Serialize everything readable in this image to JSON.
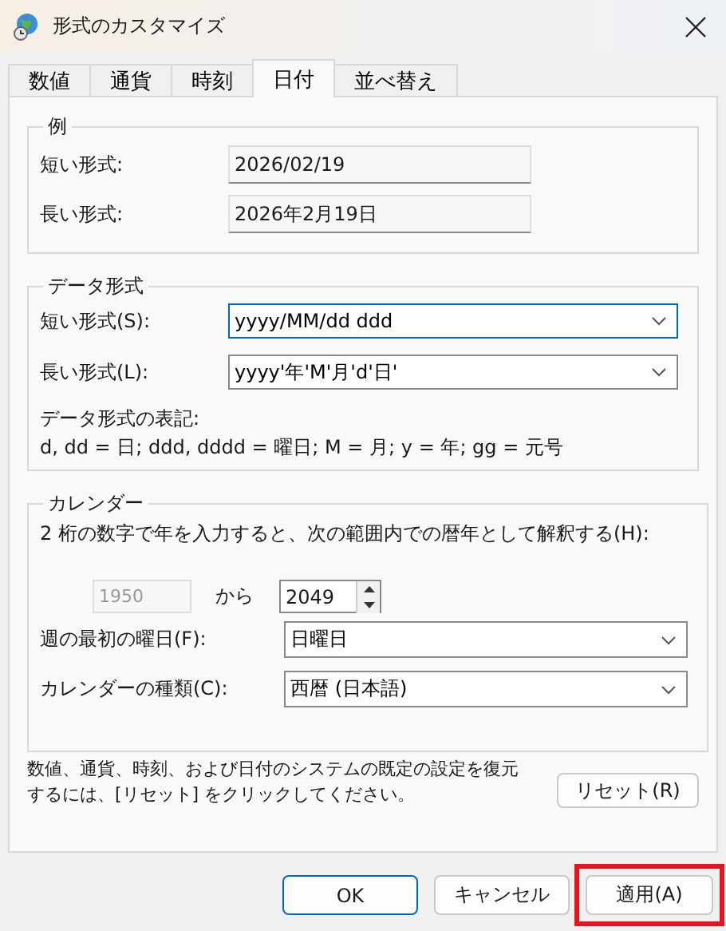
{
  "window": {
    "title": "形式のカスタマイズ"
  },
  "tabs": [
    {
      "label": "数値",
      "selected": false
    },
    {
      "label": "通貨",
      "selected": false
    },
    {
      "label": "時刻",
      "selected": false
    },
    {
      "label": "日付",
      "selected": true
    },
    {
      "label": "並べ替え",
      "selected": false
    }
  ],
  "example": {
    "title": "例",
    "rows": [
      {
        "label": "短い形式:",
        "value": "2026/02/19"
      },
      {
        "label": "長い形式:",
        "value": "2026年2月19日"
      }
    ]
  },
  "data_format": {
    "title": "データ形式",
    "fields": [
      {
        "label": "短い形式(S):",
        "value": "yyyy/MM/dd ddd",
        "focused": true
      },
      {
        "label": "長い形式(L):",
        "value": "yyyy'年'M'月'd'日'",
        "focused": false
      }
    ],
    "notation_title": "データ形式の表記:",
    "notation": "d, dd = 日;  ddd, dddd = 曜日; M = 月; y = 年; gg = 元号"
  },
  "calendar": {
    "title": "カレンダー",
    "description": "2 桁の数字で年を入力すると、次の範囲内での暦年として解釈する(H):",
    "from": {
      "value": "1950",
      "disabled": true
    },
    "to_label": "から",
    "to": {
      "value": "2049",
      "disabled": false
    },
    "fields": [
      {
        "label": "週の最初の曜日(F):",
        "value": "日曜日"
      },
      {
        "label": "カレンダーの種類(C):",
        "value": "西暦 (日本語)"
      }
    ]
  },
  "reset_note": "数値、通貨、時刻、および日付のシステムの既定の設定を復元するには、[リセット] をクリックしてください。",
  "reset_button": "リセット(R)",
  "buttons": [
    {
      "label": "OK",
      "default": true,
      "highlighted": false
    },
    {
      "label": "キャンセル",
      "default": false,
      "highlighted": false
    },
    {
      "label": "適用(A)",
      "default": false,
      "highlighted": true
    }
  ]
}
